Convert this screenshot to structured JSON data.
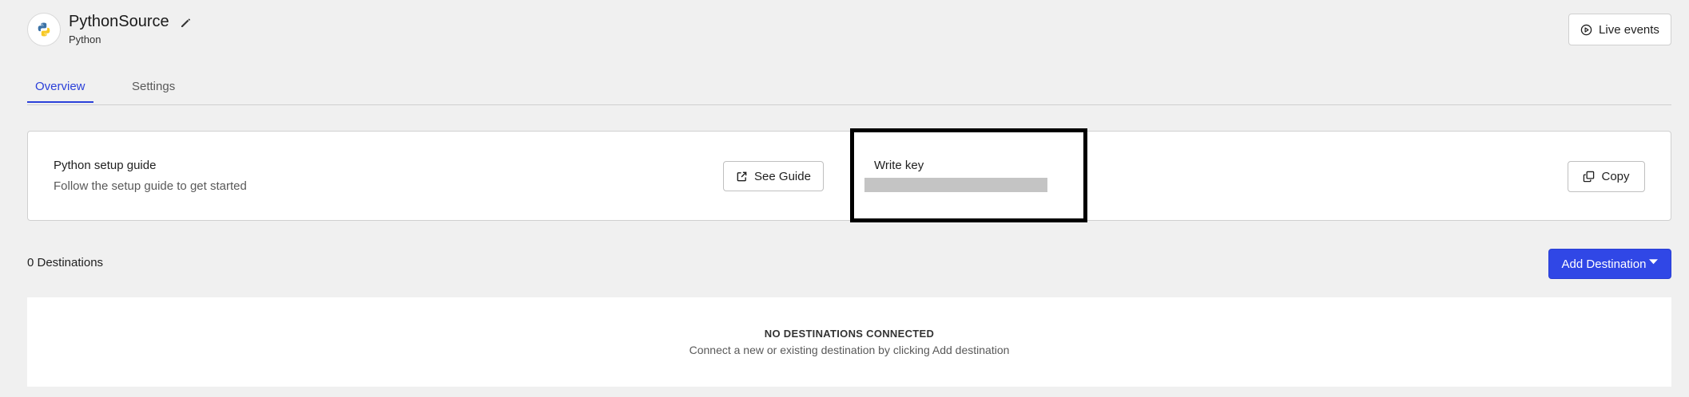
{
  "header": {
    "title": "PythonSource",
    "subtitle": "Python",
    "logo_icon": "python-logo-icon",
    "edit_icon": "pencil-icon",
    "live_events_label": "Live events",
    "live_events_icon": "play-circle-icon"
  },
  "tabs": [
    {
      "label": "Overview",
      "active": true
    },
    {
      "label": "Settings",
      "active": false
    }
  ],
  "setup_card": {
    "title": "Python setup guide",
    "description": "Follow the setup guide to get started",
    "see_guide_label": "See Guide",
    "see_guide_icon": "external-link-icon",
    "write_key_label": "Write key",
    "write_key_value": "",
    "copy_label": "Copy",
    "copy_icon": "copy-icon"
  },
  "destinations": {
    "count_label": "0 Destinations",
    "add_label": "Add Destination",
    "add_icon": "caret-down-icon",
    "empty_title": "NO DESTINATIONS CONNECTED",
    "empty_description": "Connect a new or existing destination by clicking Add destination"
  },
  "colors": {
    "accent": "#3047e6",
    "tab_active": "#2b40d9",
    "background": "#f0f0f0",
    "redacted": "#c4c4c4"
  }
}
